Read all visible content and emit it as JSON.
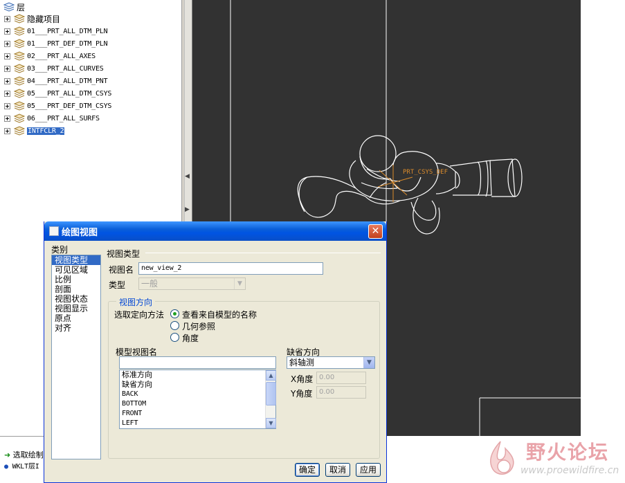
{
  "layer_tree": {
    "root_label": "层",
    "items": [
      {
        "label": "隐藏项目",
        "selected": false
      },
      {
        "label": "01___PRT_ALL_DTM_PLN",
        "selected": false
      },
      {
        "label": "01___PRT_DEF_DTM_PLN",
        "selected": false
      },
      {
        "label": "02___PRT_ALL_AXES",
        "selected": false
      },
      {
        "label": "03___PRT_ALL_CURVES",
        "selected": false
      },
      {
        "label": "04___PRT_ALL_DTM_PNT",
        "selected": false
      },
      {
        "label": "05___PRT_ALL_DTM_CSYS",
        "selected": false
      },
      {
        "label": "05___PRT_DEF_DTM_CSYS",
        "selected": false
      },
      {
        "label": "06___PRT_ALL_SURFS",
        "selected": false
      },
      {
        "label": "INTFCLR_2",
        "selected": true
      }
    ]
  },
  "graphics": {
    "csys_label": "PRT_CSYS_DEF",
    "background": "#323232",
    "model_color": "#ffffff",
    "csys_color": "#d98a2b"
  },
  "message_area": {
    "line1": "选取绘制",
    "line2": "WKLT层I"
  },
  "watermark": {
    "title": "野火论坛",
    "url": "www.proewildfire.cn"
  },
  "dialog": {
    "title": "绘图视图",
    "close_glyph": "✕",
    "category_label": "类别",
    "categories": [
      "视图类型",
      "可见区域",
      "比例",
      "剖面",
      "视图状态",
      "视图显示",
      "原点",
      "对齐"
    ],
    "active_category": 0,
    "section_title": "视图类型",
    "view_name_label": "视图名",
    "view_name_value": "new_view_2",
    "type_label": "类型",
    "type_value": "一般",
    "orientation_group_title": "视图方向",
    "orientation_method_label": "选取定向方法",
    "orientation_options": [
      "查看来自模型的名称",
      "几何参照",
      "角度"
    ],
    "orientation_selected": 0,
    "model_view_names_label": "模型视图名",
    "model_view_names_filter": "",
    "model_view_names": [
      "标准方向",
      "缺省方向",
      "BACK",
      "BOTTOM",
      "FRONT",
      "LEFT"
    ],
    "default_orientation_label": "缺省方向",
    "default_orientation_value": "斜轴测",
    "x_angle_label": "X角度",
    "x_angle_value": "0.00",
    "y_angle_label": "Y角度",
    "y_angle_value": "0.00",
    "buttons": {
      "ok": "确定",
      "cancel": "取消",
      "apply": "应用"
    }
  }
}
